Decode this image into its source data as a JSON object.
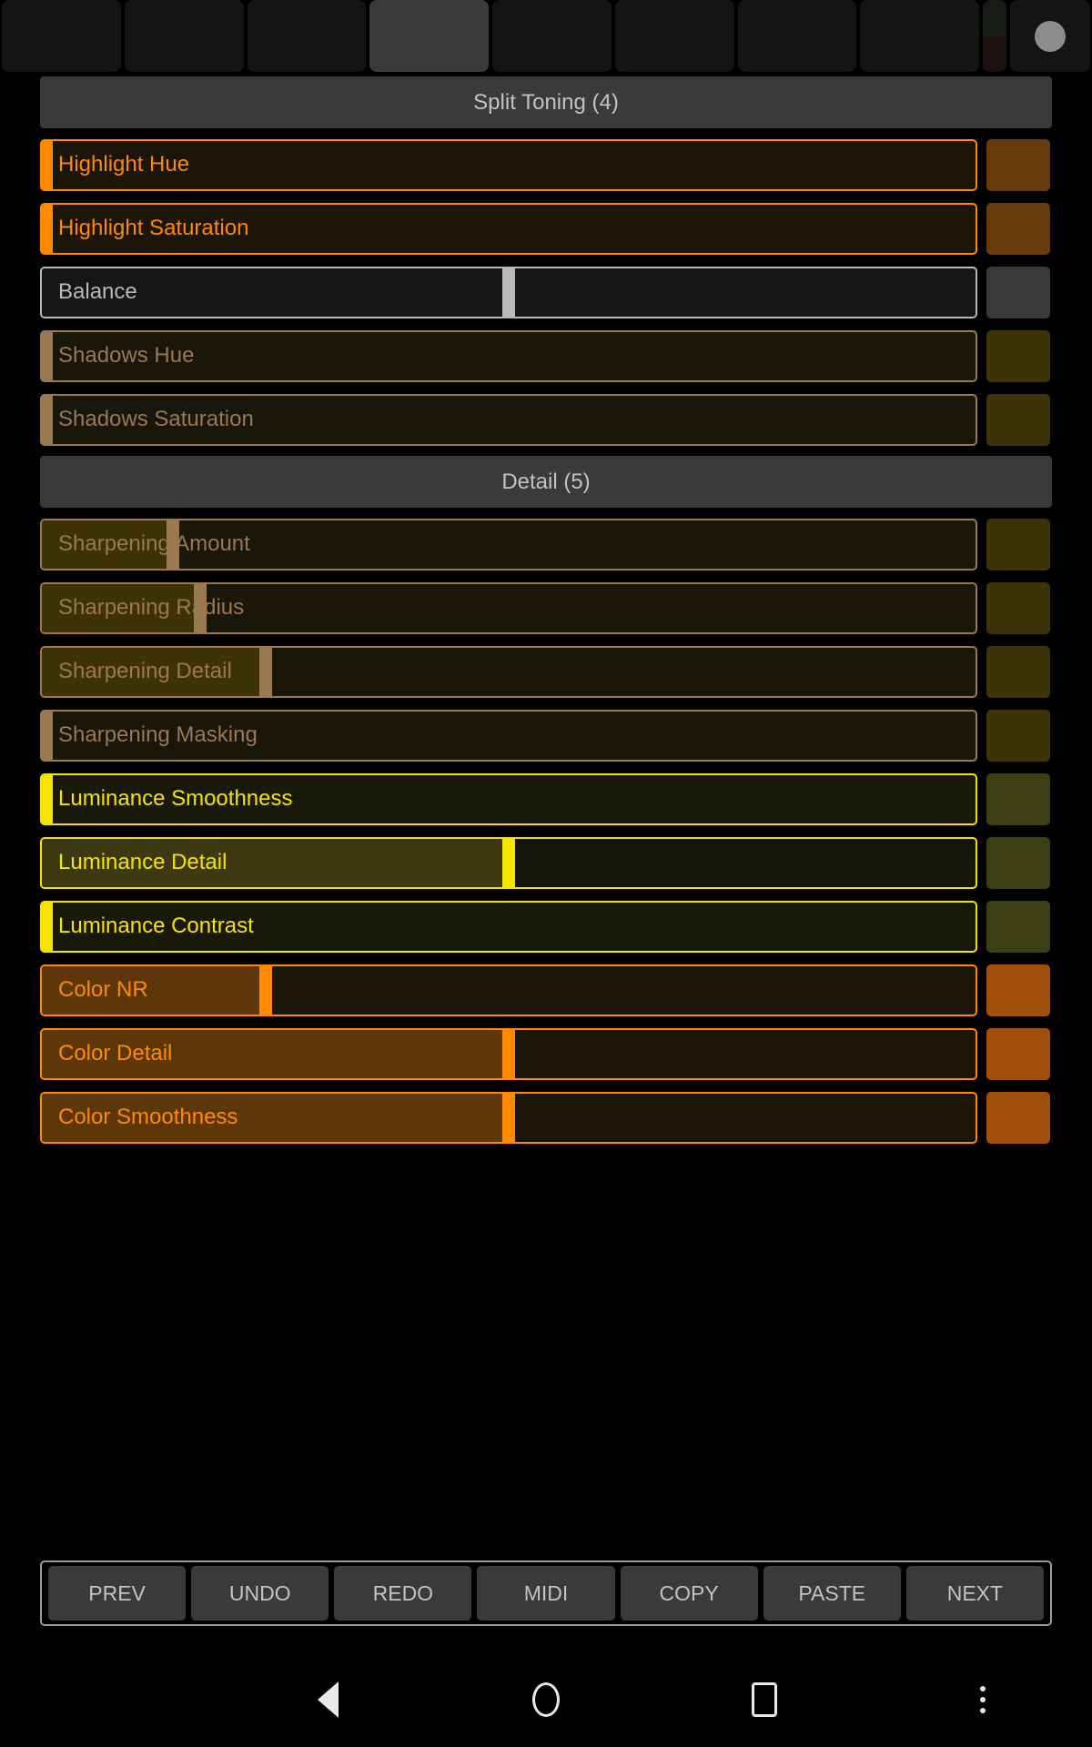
{
  "tabbar": {
    "tabs": [
      {
        "name": "tab-1",
        "selected": false
      },
      {
        "name": "tab-2",
        "selected": false
      },
      {
        "name": "tab-3",
        "selected": false
      },
      {
        "name": "tab-4",
        "selected": true
      },
      {
        "name": "tab-5",
        "selected": false
      },
      {
        "name": "tab-6",
        "selected": false
      },
      {
        "name": "tab-7",
        "selected": false
      },
      {
        "name": "tab-8",
        "selected": false
      }
    ],
    "split_tab": {
      "top_color": "#141c14",
      "bottom_color": "#1d1110"
    },
    "indicator": {
      "icon": "circle-indicator-icon",
      "color": "#8c8c8c"
    }
  },
  "sections": [
    {
      "title": "Split Toning (4)",
      "rows": [
        {
          "label": "Highlight Hue",
          "border": "#ff8a00",
          "text_color": "#ff8a00",
          "fill_color": "#1c1509",
          "track_color": "#1c1509",
          "thumb_color": "#ff8a00",
          "thumb_pct": 0,
          "fill_pct": 0,
          "swatch": "#663c0c"
        },
        {
          "label": "Highlight Saturation",
          "border": "#ff8a00",
          "text_color": "#ff8a00",
          "fill_color": "#1c1509",
          "track_color": "#1c1509",
          "thumb_color": "#ff8a00",
          "thumb_pct": 0,
          "fill_pct": 0,
          "swatch": "#663c0c"
        },
        {
          "label": "Balance",
          "border": "#b9b9b9",
          "text_color": "#b9b9b9",
          "fill_color": "#161616",
          "track_color": "#161616",
          "thumb_color": "#b9b9b9",
          "thumb_pct": 50,
          "fill_pct": 50,
          "swatch": "#3a3a3a"
        },
        {
          "label": "Shadows Hue",
          "border": "#9a7850",
          "text_color": "#9a7850",
          "fill_color": "#18170a",
          "track_color": "#18170a",
          "thumb_color": "#9a7850",
          "thumb_pct": 0,
          "fill_pct": 0,
          "swatch": "#3d3208"
        },
        {
          "label": "Shadows Saturation",
          "border": "#9a7850",
          "text_color": "#9a7850",
          "fill_color": "#18170a",
          "track_color": "#18170a",
          "thumb_color": "#9a7850",
          "thumb_pct": 0,
          "fill_pct": 0,
          "swatch": "#3d3208"
        }
      ]
    },
    {
      "title": "Detail (5)",
      "rows": [
        {
          "label": "Sharpening Amount",
          "border": "#9a7850",
          "text_color": "#9a7850",
          "fill_color": "#3d3208",
          "track_color": "#18170a",
          "thumb_color": "#9a7850",
          "thumb_pct": 14,
          "fill_pct": 14,
          "swatch": "#3d3208"
        },
        {
          "label": "Sharpening Radius",
          "border": "#9a7850",
          "text_color": "#9a7850",
          "fill_color": "#3d3208",
          "track_color": "#18170a",
          "thumb_color": "#9a7850",
          "thumb_pct": 17,
          "fill_pct": 17,
          "swatch": "#3d3208"
        },
        {
          "label": "Sharpening Detail",
          "border": "#9a7850",
          "text_color": "#9a7850",
          "fill_color": "#3d3208",
          "track_color": "#18170a",
          "thumb_color": "#9a7850",
          "thumb_pct": 24,
          "fill_pct": 24,
          "swatch": "#3d3208"
        },
        {
          "label": "Sharpening Masking",
          "border": "#9a7850",
          "text_color": "#9a7850",
          "fill_color": "#18170a",
          "track_color": "#18170a",
          "thumb_color": "#9a7850",
          "thumb_pct": 0,
          "fill_pct": 0,
          "swatch": "#3d3208"
        },
        {
          "label": "Luminance Smoothness",
          "border": "#f5e400",
          "text_color": "#f5e400",
          "fill_color": "#191909",
          "track_color": "#191909",
          "thumb_color": "#f5e400",
          "thumb_pct": 0,
          "fill_pct": 0,
          "swatch": "#3c3f12"
        },
        {
          "label": "Luminance Detail",
          "border": "#f5e400",
          "text_color": "#f5e400",
          "fill_color": "#3c3812",
          "track_color": "#151509",
          "thumb_color": "#f5e400",
          "thumb_pct": 50,
          "fill_pct": 50,
          "swatch": "#3c3f12"
        },
        {
          "label": "Luminance Contrast",
          "border": "#f5e400",
          "text_color": "#f5e400",
          "fill_color": "#191909",
          "track_color": "#191909",
          "thumb_color": "#f5e400",
          "thumb_pct": 0,
          "fill_pct": 0,
          "swatch": "#3c3f12"
        },
        {
          "label": "Color NR",
          "border": "#ff8a00",
          "text_color": "#ff8a00",
          "fill_color": "#5d3708",
          "track_color": "#1c1509",
          "thumb_color": "#ff8a00",
          "thumb_pct": 24,
          "fill_pct": 24,
          "swatch": "#a0500a"
        },
        {
          "label": "Color Detail",
          "border": "#ff8a00",
          "text_color": "#ff8a00",
          "fill_color": "#5d3708",
          "track_color": "#1c1509",
          "thumb_color": "#ff8a00",
          "thumb_pct": 50,
          "fill_pct": 50,
          "swatch": "#a0500a"
        },
        {
          "label": "Color Smoothness",
          "border": "#ff8a00",
          "text_color": "#ff8a00",
          "fill_color": "#5d3708",
          "track_color": "#1c1509",
          "thumb_color": "#ff8a00",
          "thumb_pct": 50,
          "fill_pct": 50,
          "swatch": "#a0500a"
        }
      ]
    }
  ],
  "buttonbar": {
    "buttons": [
      "PREV",
      "UNDO",
      "REDO",
      "MIDI",
      "COPY",
      "PASTE",
      "NEXT"
    ]
  },
  "navbar": {
    "items": [
      {
        "name": "nav-back-icon"
      },
      {
        "name": "nav-home-icon"
      },
      {
        "name": "nav-recents-icon"
      },
      {
        "name": "nav-overflow-icon"
      }
    ]
  }
}
